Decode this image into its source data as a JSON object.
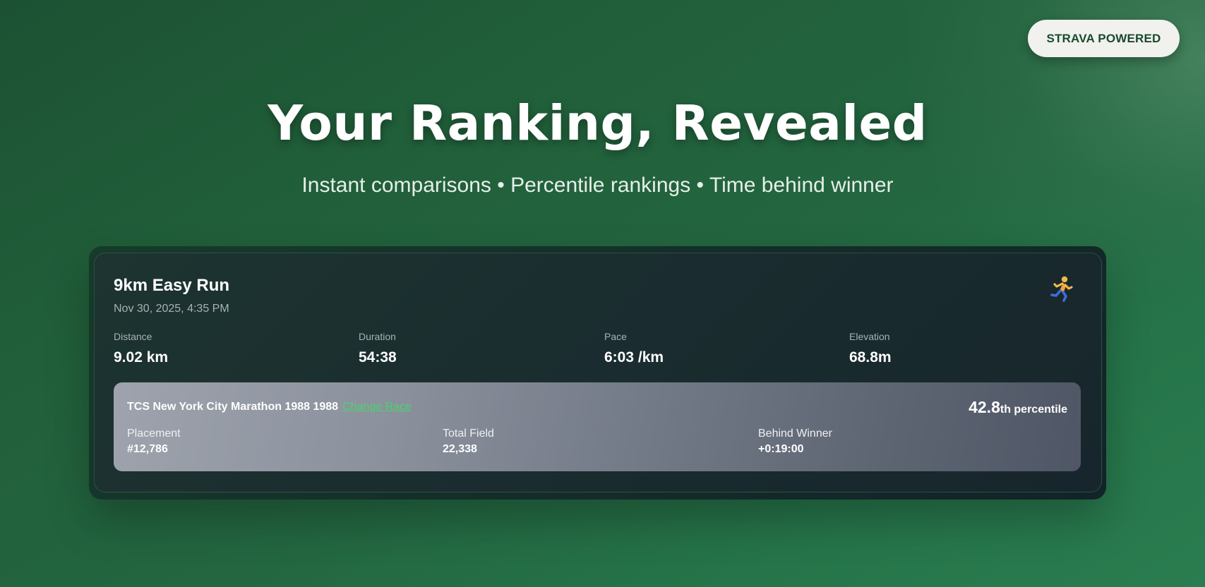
{
  "badge": {
    "label": "STRAVA POWERED"
  },
  "hero": {
    "title": "Your Ranking, Revealed",
    "subtitle": "Instant comparisons • Percentile rankings • Time behind winner"
  },
  "activity": {
    "title": "9km Easy Run",
    "date": "Nov 30, 2025, 4:35 PM",
    "icon": "runner-icon",
    "stats": [
      {
        "label": "Distance",
        "value": "9.02 km"
      },
      {
        "label": "Duration",
        "value": "54:38"
      },
      {
        "label": "Pace",
        "value": "6:03 /km"
      },
      {
        "label": "Elevation",
        "value": "68.8m"
      }
    ]
  },
  "race": {
    "name": "TCS New York City Marathon 1988 1988",
    "change_label": "Change Race",
    "percentile_value": "42.8",
    "percentile_suffix": "th percentile",
    "stats": [
      {
        "label": "Placement",
        "value": "#12,786"
      },
      {
        "label": "Total Field",
        "value": "22,338"
      },
      {
        "label": "Behind Winner",
        "value": "+0:19:00"
      }
    ]
  },
  "colors": {
    "background": "#236640",
    "card": "#1a2c2f",
    "accent_link": "#4cd36f",
    "badge_text": "#1a4a2c"
  }
}
